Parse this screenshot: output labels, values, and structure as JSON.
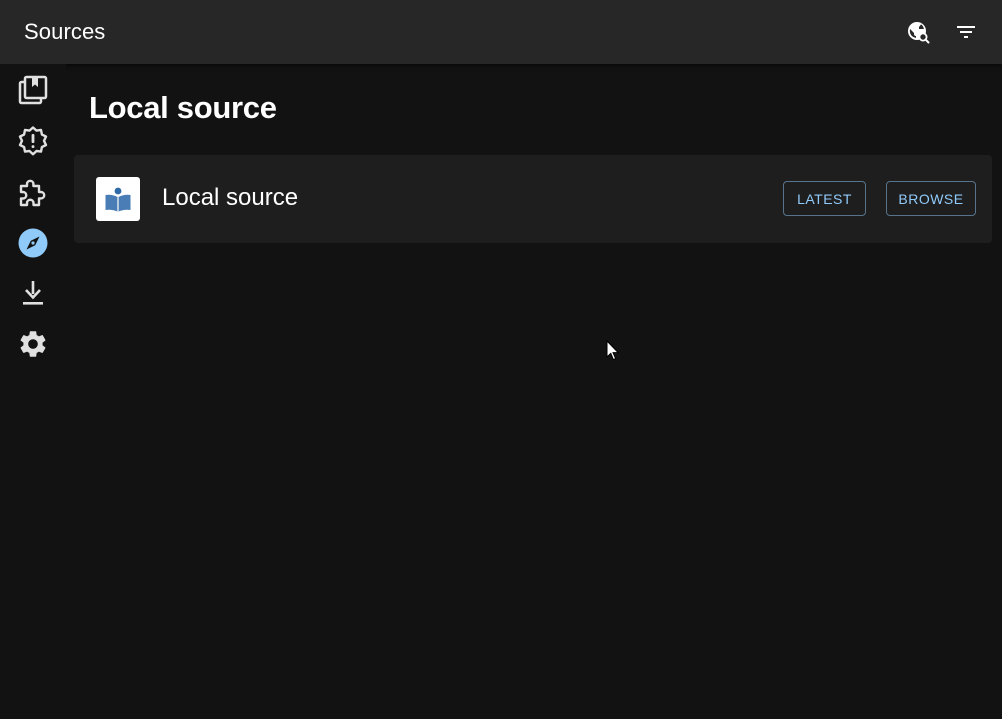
{
  "appbar": {
    "title": "Sources",
    "actions": [
      {
        "icon": "language-search-icon"
      },
      {
        "icon": "filter-icon"
      }
    ]
  },
  "sidebar": {
    "items": [
      {
        "icon": "library-icon",
        "active": false
      },
      {
        "icon": "updates-icon",
        "active": false
      },
      {
        "icon": "extensions-icon",
        "active": false
      },
      {
        "icon": "explore-icon",
        "active": true
      },
      {
        "icon": "downloads-icon",
        "active": false
      },
      {
        "icon": "settings-icon",
        "active": false
      }
    ]
  },
  "main": {
    "section_title": "Local source",
    "sources": [
      {
        "name": "Local source",
        "latest_label": "LATEST",
        "browse_label": "BROWSE"
      }
    ]
  },
  "colors": {
    "background": "#121212",
    "appbar": "#272727",
    "card": "#1e1e1e",
    "accent": "#90caf9",
    "icon": "#ffffff"
  }
}
